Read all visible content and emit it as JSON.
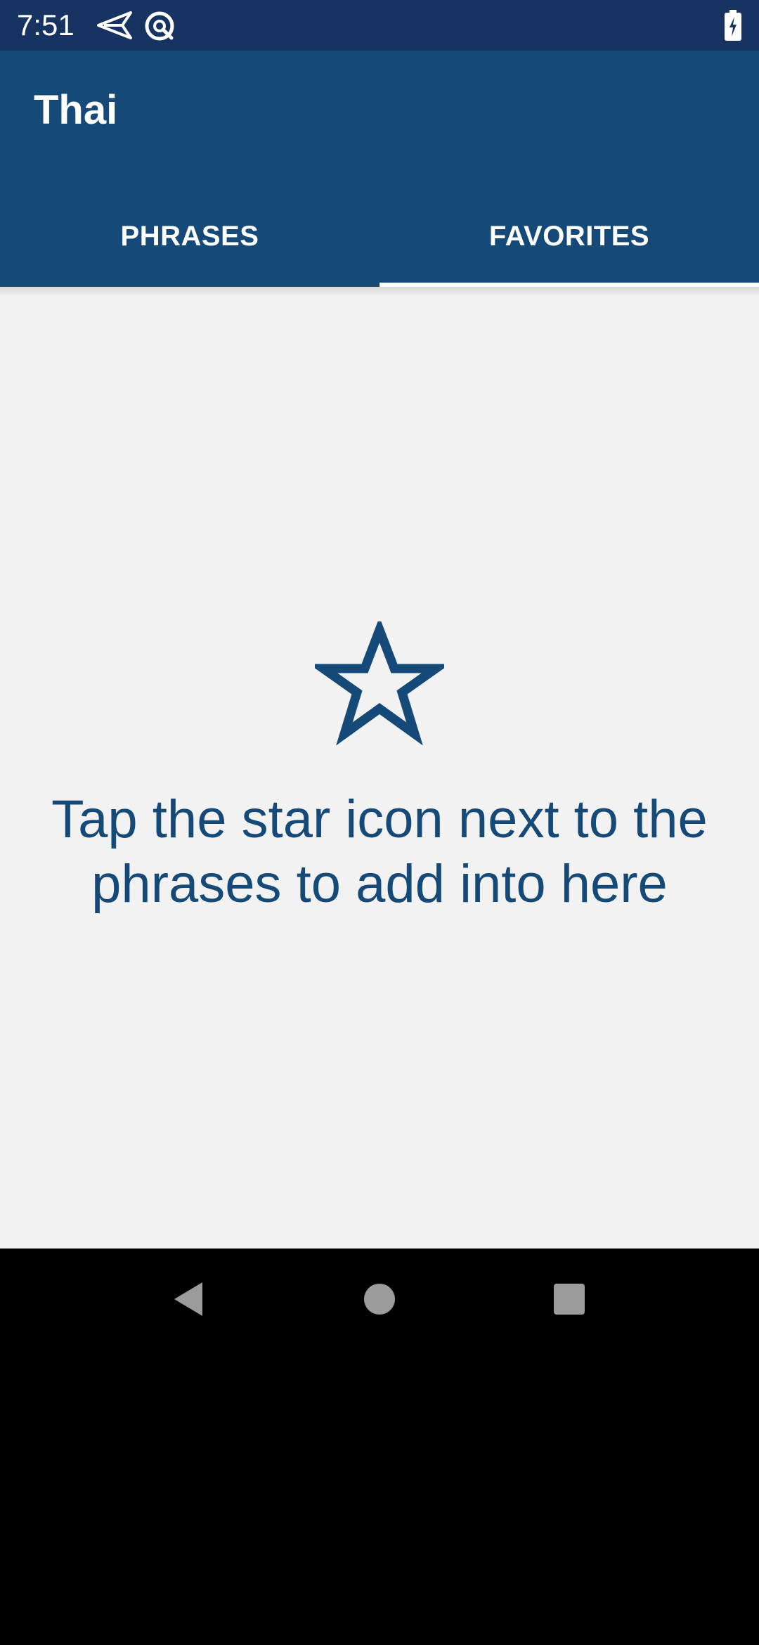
{
  "status_bar": {
    "time": "7:51",
    "icons": [
      "send-icon",
      "data-saver-icon",
      "battery-charging-icon"
    ]
  },
  "app_bar": {
    "title": "Thai"
  },
  "tabs": [
    {
      "label": "PHRASES",
      "selected": false
    },
    {
      "label": "FAVORITES",
      "selected": true
    }
  ],
  "empty_state": {
    "icon": "star-outline-icon",
    "message": "Tap the star icon next to the phrases to add into here"
  },
  "nav_bar": {
    "buttons": [
      "back-icon",
      "home-icon",
      "recents-icon"
    ]
  },
  "colors": {
    "status_bar": "#173361",
    "primary": "#154a78",
    "background": "#f2f2f2",
    "nav_bar": "#000000"
  }
}
